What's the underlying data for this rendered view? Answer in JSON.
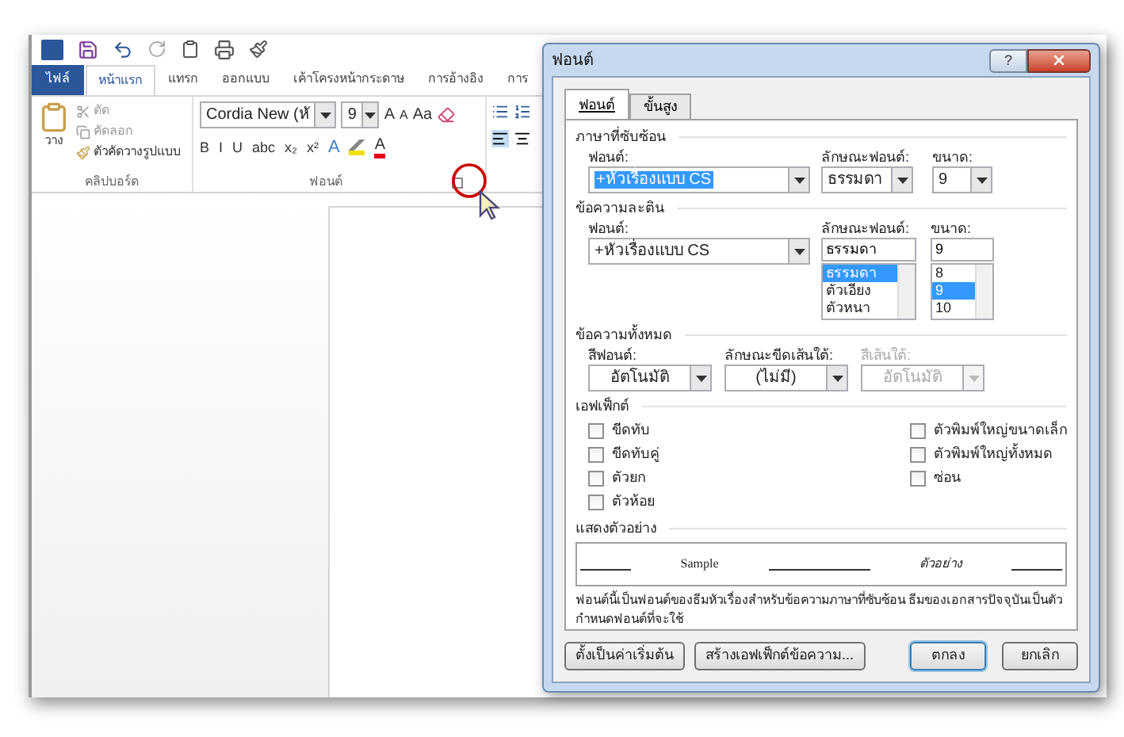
{
  "word": {
    "tabs": [
      {
        "label": "ไฟล์",
        "kind": "file",
        "selected": false
      },
      {
        "label": "หน้าแรก",
        "kind": "tab",
        "selected": true
      },
      {
        "label": "แทรก",
        "kind": "tab",
        "selected": false
      },
      {
        "label": "ออกแบบ",
        "kind": "tab",
        "selected": false
      },
      {
        "label": "เค้าโครงหน้ากระดาษ",
        "kind": "tab",
        "selected": false
      },
      {
        "label": "การอ้างอิง",
        "kind": "tab",
        "selected": false
      },
      {
        "label": "การ",
        "kind": "tab",
        "selected": false
      }
    ],
    "clipboard": {
      "paste": "วาง",
      "cut": "ตัด",
      "copy": "คัดลอก",
      "format_painter": "ตัวคัดวางรูปแบบ",
      "group_label": "คลิปบอร์ด"
    },
    "font_group": {
      "font_name": "Cordia New (หั",
      "font_size": "9",
      "grow": "A",
      "shrink": "A",
      "change_case": "Aa",
      "format_buttons": [
        "B",
        "I",
        "U",
        "abc",
        "x₂",
        "x²"
      ],
      "effects": "A",
      "font_color": "A",
      "group_label": "ฟอนต์"
    }
  },
  "dialog": {
    "title": "ฟอนต์",
    "help": "?",
    "tabs": [
      {
        "label": "ฟอนต์",
        "selected": true
      },
      {
        "label": "ขั้นสูง",
        "selected": false
      }
    ],
    "complex": {
      "heading": "ภาษาที่ซับซ้อน",
      "font_label": "ฟอนต์:",
      "font": "+หัวเรื่องแบบ CS",
      "style_label": "ลักษณะฟอนต์:",
      "style": "ธรรมดา",
      "size_label": "ขนาด:",
      "size": "9"
    },
    "latin": {
      "heading": "ข้อความละติน",
      "font_label": "ฟอนต์:",
      "font": "+หัวเรื่องแบบ CS",
      "style_label": "ลักษณะฟอนต์:",
      "style": "ธรรมดา",
      "style_options": [
        {
          "label": "ธรรมดา",
          "selected": true
        },
        {
          "label": "ตัวเอียง",
          "selected": false
        },
        {
          "label": "ตัวหนา",
          "selected": false
        }
      ],
      "size_label": "ขนาด:",
      "size": "9",
      "size_options": [
        {
          "label": "8",
          "selected": false
        },
        {
          "label": "9",
          "selected": true
        },
        {
          "label": "10",
          "selected": false
        }
      ]
    },
    "all_text": {
      "heading": "ข้อความทั้งหมด",
      "fields": [
        {
          "label": "สีฟอนต์:",
          "value": "อัตโนมัติ",
          "disabled": false
        },
        {
          "label": "ลักษณะขีดเส้นใต้:",
          "value": "(ไม่มี)",
          "disabled": false
        },
        {
          "label": "สีเส้นใต้:",
          "value": "อัตโนมัติ",
          "disabled": true
        }
      ]
    },
    "effects": {
      "heading": "เอฟเฟ็กต์",
      "left": [
        {
          "label": "ขีดทับ",
          "checked": false
        },
        {
          "label": "ขีดทับคู่",
          "checked": false
        },
        {
          "label": "ตัวยก",
          "checked": false
        },
        {
          "label": "ตัวห้อย",
          "checked": false
        }
      ],
      "right": [
        {
          "label": "ตัวพิมพ์ใหญ่ขนาดเล็ก",
          "checked": false
        },
        {
          "label": "ตัวพิมพ์ใหญ่ทั้งหมด",
          "checked": false
        },
        {
          "label": "ซ่อน",
          "checked": false
        }
      ]
    },
    "preview": {
      "heading": "แสดงตัวอย่าง",
      "sample": "Sample",
      "sample_thai": "ตัวอย่าง",
      "note": "ฟอนต์นี้เป็นฟอนต์ของธีมหัวเรื่องสำหรับข้อความภาษาที่ซับซ้อน ธีมของเอกสารปัจจุบันเป็นตัวกำหนดฟอนต์ที่จะใช้"
    },
    "buttons": [
      {
        "label": "ตั้งเป็นค่าเริ่มต้น",
        "kind": "left"
      },
      {
        "label": "สร้างเอฟเฟ็กต์ข้อความ...",
        "kind": "left"
      },
      {
        "label": "ตกลง",
        "kind": "default"
      },
      {
        "label": "ยกเลิก",
        "kind": "right"
      }
    ]
  }
}
